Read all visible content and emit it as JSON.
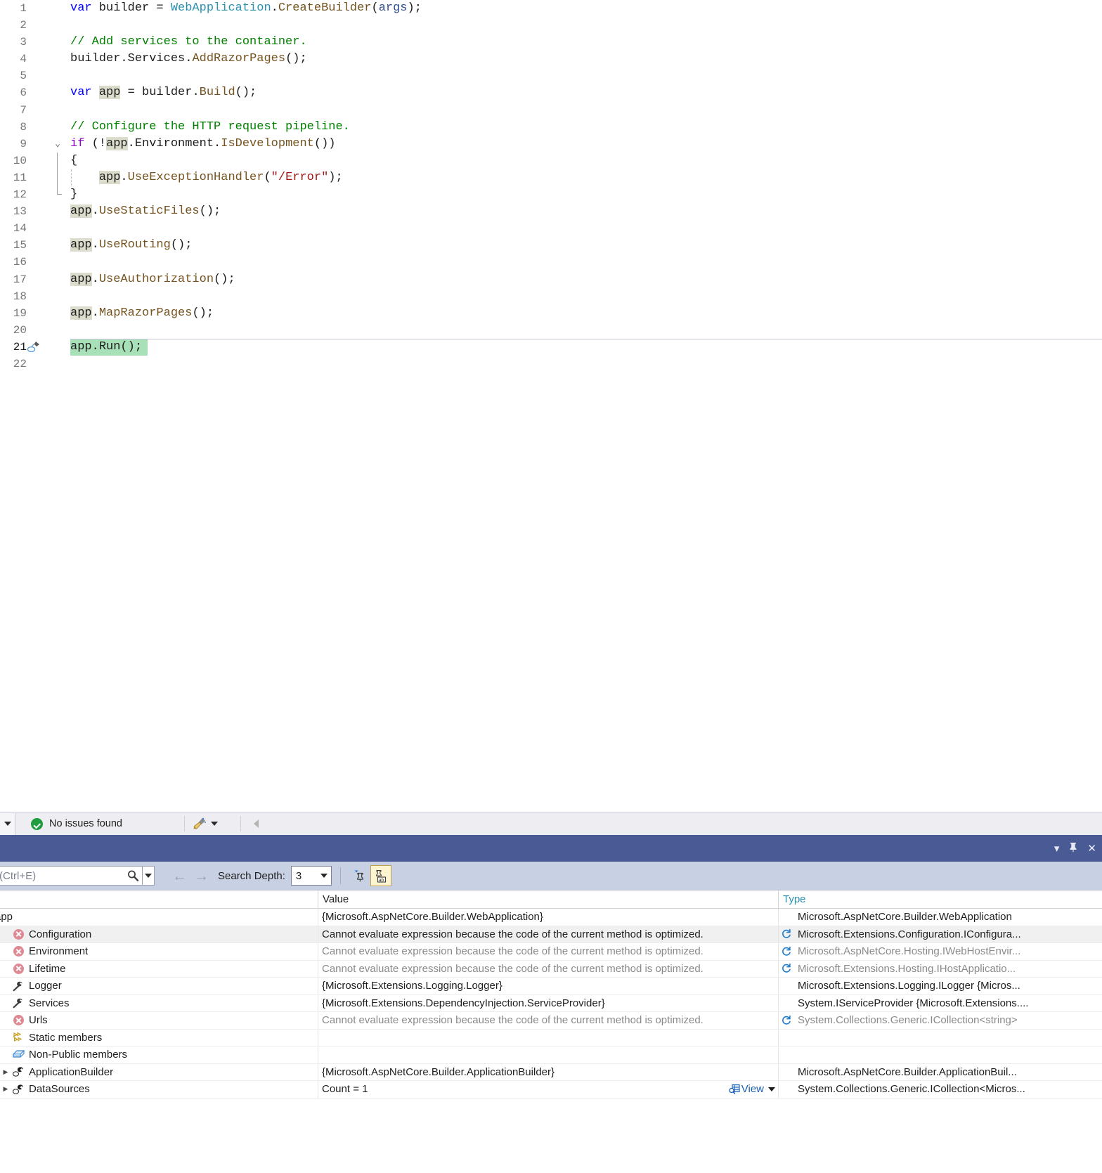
{
  "editor": {
    "lines": [
      {
        "n": "1",
        "tokens": [
          {
            "t": "var",
            "c": "kw"
          },
          {
            "t": " builder = ",
            "c": "plain"
          },
          {
            "t": "WebApplication",
            "c": "type"
          },
          {
            "t": ".",
            "c": "plain"
          },
          {
            "t": "CreateBuilder",
            "c": "meth"
          },
          {
            "t": "(",
            "c": "plain"
          },
          {
            "t": "args",
            "c": "param"
          },
          {
            "t": ");",
            "c": "plain"
          }
        ],
        "indent": 0
      },
      {
        "n": "2",
        "tokens": [],
        "indent": 0
      },
      {
        "n": "3",
        "tokens": [
          {
            "t": "// Add services to the container.",
            "c": "com"
          }
        ],
        "indent": 0
      },
      {
        "n": "4",
        "tokens": [
          {
            "t": "builder",
            "c": "plain"
          },
          {
            "t": ".",
            "c": "plain"
          },
          {
            "t": "Services",
            "c": "plain"
          },
          {
            "t": ".",
            "c": "plain"
          },
          {
            "t": "AddRazorPages",
            "c": "meth"
          },
          {
            "t": "();",
            "c": "plain"
          }
        ],
        "indent": 0
      },
      {
        "n": "5",
        "tokens": [],
        "indent": 0
      },
      {
        "n": "6",
        "tokens": [
          {
            "t": "var",
            "c": "kw"
          },
          {
            "t": " ",
            "c": "plain"
          },
          {
            "t": "app",
            "c": "plain hl-ref"
          },
          {
            "t": " = builder.",
            "c": "plain"
          },
          {
            "t": "Build",
            "c": "meth"
          },
          {
            "t": "();",
            "c": "plain"
          }
        ],
        "indent": 0
      },
      {
        "n": "7",
        "tokens": [],
        "indent": 0
      },
      {
        "n": "8",
        "tokens": [
          {
            "t": "// Configure the HTTP request pipeline.",
            "c": "com"
          }
        ],
        "indent": 0
      },
      {
        "n": "9",
        "tokens": [
          {
            "t": "if",
            "c": "kwp"
          },
          {
            "t": " (!",
            "c": "plain"
          },
          {
            "t": "app",
            "c": "plain hl-ref"
          },
          {
            "t": ".Environment.",
            "c": "plain"
          },
          {
            "t": "IsDevelopment",
            "c": "meth"
          },
          {
            "t": "())",
            "c": "plain"
          }
        ],
        "indent": 0,
        "fold": "collapse"
      },
      {
        "n": "10",
        "tokens": [
          {
            "t": "{",
            "c": "plain"
          }
        ],
        "indent": 0,
        "bar": true
      },
      {
        "n": "11",
        "tokens": [
          {
            "t": "    ",
            "c": "plain"
          },
          {
            "t": "app",
            "c": "plain hl-ref"
          },
          {
            "t": ".",
            "c": "plain"
          },
          {
            "t": "UseExceptionHandler",
            "c": "meth"
          },
          {
            "t": "(",
            "c": "plain"
          },
          {
            "t": "\"/Error\"",
            "c": "str"
          },
          {
            "t": ");",
            "c": "plain"
          }
        ],
        "indent": 0,
        "bar": true
      },
      {
        "n": "12",
        "tokens": [
          {
            "t": "}",
            "c": "plain"
          }
        ],
        "indent": 0,
        "bar": true
      },
      {
        "n": "13",
        "tokens": [
          {
            "t": "app",
            "c": "plain hl-ref"
          },
          {
            "t": ".",
            "c": "plain"
          },
          {
            "t": "UseStaticFiles",
            "c": "meth"
          },
          {
            "t": "();",
            "c": "plain"
          }
        ],
        "indent": 0
      },
      {
        "n": "14",
        "tokens": [],
        "indent": 0
      },
      {
        "n": "15",
        "tokens": [
          {
            "t": "app",
            "c": "plain hl-ref"
          },
          {
            "t": ".",
            "c": "plain"
          },
          {
            "t": "UseRouting",
            "c": "meth"
          },
          {
            "t": "();",
            "c": "plain"
          }
        ],
        "indent": 0
      },
      {
        "n": "16",
        "tokens": [],
        "indent": 0
      },
      {
        "n": "17",
        "tokens": [
          {
            "t": "app",
            "c": "plain hl-ref"
          },
          {
            "t": ".",
            "c": "plain"
          },
          {
            "t": "UseAuthorization",
            "c": "meth"
          },
          {
            "t": "();",
            "c": "plain"
          }
        ],
        "indent": 0
      },
      {
        "n": "18",
        "tokens": [],
        "indent": 0
      },
      {
        "n": "19",
        "tokens": [
          {
            "t": "app",
            "c": "plain hl-ref"
          },
          {
            "t": ".",
            "c": "plain"
          },
          {
            "t": "MapRazorPages",
            "c": "meth"
          },
          {
            "t": "();",
            "c": "plain"
          }
        ],
        "indent": 0
      },
      {
        "n": "20",
        "tokens": [],
        "indent": 0
      },
      {
        "n": "21",
        "tokens": [
          {
            "t": "app",
            "c": "plain"
          },
          {
            "t": ".",
            "c": "plain"
          },
          {
            "t": "Run",
            "c": "plain"
          },
          {
            "t": "();",
            "c": "plain"
          }
        ],
        "indent": 0,
        "current": true,
        "glyph": "hot-reload-icon",
        "highlight_width": 110
      },
      {
        "n": "22",
        "tokens": [],
        "indent": 0
      }
    ],
    "current_line_color": "#a8e0b8",
    "reference_highlight_color": "#dbdccb"
  },
  "status_bar": {
    "issues_text": "No issues found",
    "issues_icon": "check-circle-icon",
    "dropdown_icon": "chevron-down-icon",
    "broom_icon": "broom-icon",
    "broom_dropdown_icon": "chevron-down-icon",
    "collapse_icon": "chevron-left-icon"
  },
  "tool_window": {
    "titlebar": {
      "menu_icon": "chevron-down-icon",
      "pin_icon": "pin-icon",
      "close_icon": "close-icon"
    },
    "toolbar": {
      "search_placeholder": "(Ctrl+E)",
      "search_icon": "search-icon",
      "search_dropdown_icon": "chevron-down-icon",
      "back_icon": "arrow-left-icon",
      "forward_icon": "arrow-right-icon",
      "depth_label": "Search Depth:",
      "depth_value": "3",
      "depth_dropdown_icon": "chevron-down-icon",
      "pin_button_icon": "pin-to-source-icon",
      "format_button_icon": "show-raw-values-icon",
      "format_button_active": true
    },
    "grid": {
      "columns": [
        "",
        "Value",
        "Type"
      ],
      "rows": [
        {
          "name": "app",
          "name_clipped": true,
          "icon": "",
          "expander": "",
          "value": "{Microsoft.AspNetCore.Builder.WebApplication}",
          "value_dim": false,
          "type": "Microsoft.AspNetCore.Builder.WebApplication",
          "type_dim": false,
          "refresh": false,
          "selected": false
        },
        {
          "name": "Configuration",
          "icon": "error-icon",
          "expander": "",
          "value": "Cannot evaluate expression because the code of the current method is optimized.",
          "value_dim": false,
          "type": "Microsoft.Extensions.Configuration.IConfigura...",
          "type_dim": false,
          "refresh": true,
          "selected": true
        },
        {
          "name": "Environment",
          "icon": "error-icon",
          "expander": "",
          "value": "Cannot evaluate expression because the code of the current method is optimized.",
          "value_dim": true,
          "type": "Microsoft.AspNetCore.Hosting.IWebHostEnvir...",
          "type_dim": true,
          "refresh": true,
          "selected": false
        },
        {
          "name": "Lifetime",
          "icon": "error-icon",
          "expander": "",
          "value": "Cannot evaluate expression because the code of the current method is optimized.",
          "value_dim": true,
          "type": "Microsoft.Extensions.Hosting.IHostApplicatio...",
          "type_dim": true,
          "refresh": true,
          "selected": false
        },
        {
          "name": "Logger",
          "icon": "property-icon",
          "expander": "",
          "value": "{Microsoft.Extensions.Logging.Logger}",
          "value_dim": false,
          "type": "Microsoft.Extensions.Logging.ILogger {Micros...",
          "type_dim": false,
          "refresh": false,
          "selected": false
        },
        {
          "name": "Services",
          "icon": "property-icon",
          "expander": "",
          "value": "{Microsoft.Extensions.DependencyInjection.ServiceProvider}",
          "value_dim": false,
          "type": "System.IServiceProvider {Microsoft.Extensions....",
          "type_dim": false,
          "refresh": false,
          "selected": false
        },
        {
          "name": "Urls",
          "icon": "error-icon",
          "expander": "",
          "value": "Cannot evaluate expression because the code of the current method is optimized.",
          "value_dim": true,
          "type": "System.Collections.Generic.ICollection<string>",
          "type_dim": true,
          "refresh": true,
          "selected": false
        },
        {
          "name": "Static members",
          "icon": "static-members-icon",
          "expander": "",
          "value": "",
          "value_dim": false,
          "type": "",
          "type_dim": false,
          "refresh": false,
          "selected": false
        },
        {
          "name": "Non-Public members",
          "icon": "non-public-members-icon",
          "expander": "",
          "value": "",
          "value_dim": false,
          "type": "",
          "type_dim": false,
          "refresh": false,
          "selected": false
        },
        {
          "name": "ApplicationBuilder",
          "icon": "private-field-icon",
          "expander": "▶",
          "value": "{Microsoft.AspNetCore.Builder.ApplicationBuilder}",
          "value_dim": false,
          "type": "Microsoft.AspNetCore.Builder.ApplicationBuil...",
          "type_dim": false,
          "refresh": false,
          "selected": false
        },
        {
          "name": "DataSources",
          "icon": "private-field-icon",
          "expander": "▶",
          "value": "Count = 1",
          "value_dim": false,
          "value_link": "View",
          "value_link_icon": "magnifier-grid-icon",
          "value_link_dropdown_icon": "chevron-down-icon",
          "type": "System.Collections.Generic.ICollection<Micros...",
          "type_dim": false,
          "refresh": false,
          "selected": false
        }
      ]
    }
  }
}
